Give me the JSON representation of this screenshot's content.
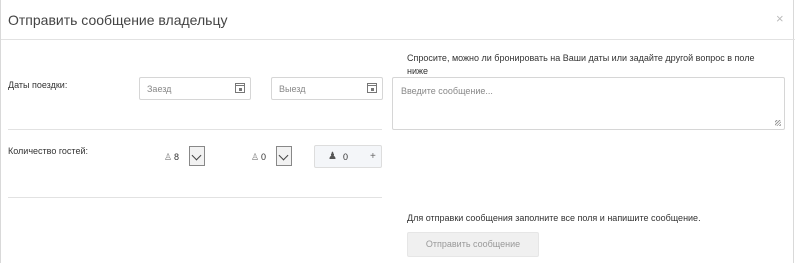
{
  "dialog": {
    "title": "Отправить сообщение владельцу",
    "close_glyph": "×"
  },
  "dates": {
    "label": "Даты поездки:",
    "checkin_placeholder": "Заезд",
    "checkout_placeholder": "Выезд",
    "icon": "calendar-icon"
  },
  "guests": {
    "label": "Количество гостей:",
    "adults_value": "8",
    "children_value": "0",
    "infants_value": "0",
    "plus_glyph": "+",
    "icons": {
      "adult": "person-icon",
      "child": "child-icon",
      "infant": "infant-icon"
    }
  },
  "message": {
    "prompt": "Спросите, можно ли бронировать на Ваши даты или задайте другой вопрос в поле ниже",
    "placeholder": "Введите сообщение..."
  },
  "footer": {
    "hint": "Для отправки сообщения заполните все поля и напишите сообщение.",
    "send_label": "Отправить сообщение"
  }
}
